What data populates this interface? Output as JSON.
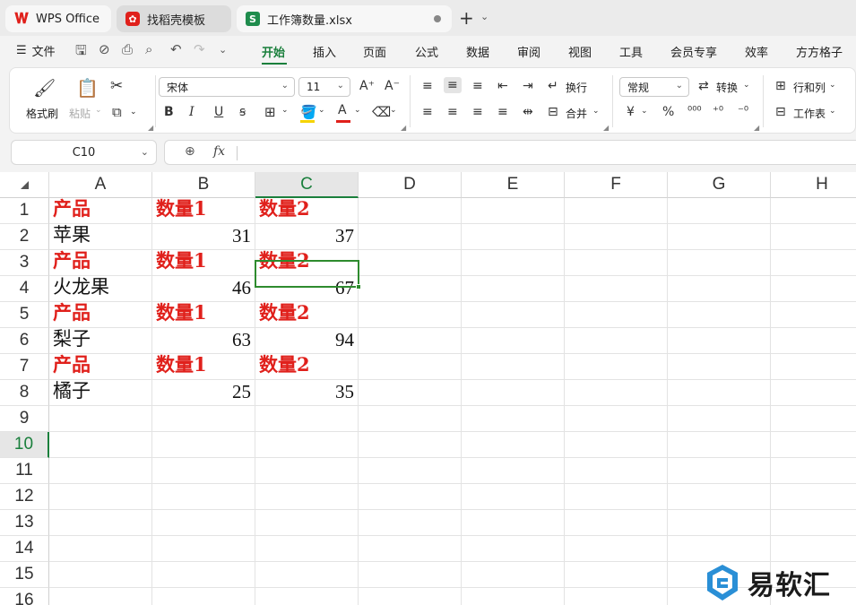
{
  "tabs": [
    {
      "label": "WPS Office",
      "icon": "wps-logo-icon"
    },
    {
      "label": "找稻壳模板",
      "icon": "docer-icon"
    },
    {
      "label": "工作簿数量.xlsx",
      "icon": "spreadsheet-s-icon",
      "badge": "S"
    }
  ],
  "menu": {
    "file": "文件",
    "items": [
      "开始",
      "插入",
      "页面",
      "公式",
      "数据",
      "审阅",
      "视图",
      "工具",
      "会员专享",
      "效率",
      "方方格子"
    ],
    "active": "开始"
  },
  "ribbon": {
    "format_painter": "格式刷",
    "paste": "粘贴",
    "font_name": "宋体",
    "font_size": "11",
    "wrap": "换行",
    "merge": "合并",
    "number_format": "常规",
    "convert": "转换",
    "rows_cols": "行和列",
    "worksheet": "工作表",
    "bold": "B",
    "italic": "I",
    "underline": "U",
    "strike": "ꞩ",
    "percent": "%",
    "font_color_letter": "A",
    "currency": "¥",
    "font_grow": "A⁺",
    "font_shrink": "A⁻"
  },
  "formula_bar": {
    "name_box": "C10",
    "fx": "fx",
    "formula": ""
  },
  "sheet": {
    "columns": [
      "A",
      "B",
      "C",
      "D",
      "E",
      "F",
      "G",
      "H"
    ],
    "rows": [
      "1",
      "2",
      "3",
      "4",
      "5",
      "6",
      "7",
      "8",
      "9",
      "10",
      "11",
      "12",
      "13",
      "14",
      "15",
      "16"
    ],
    "selected_column": "C",
    "selected_row": "10",
    "cells": [
      [
        "产品",
        "数量1",
        "数量2"
      ],
      [
        "苹果",
        "31",
        "37"
      ],
      [
        "产品",
        "数量1",
        "数量2"
      ],
      [
        "火龙果",
        "46",
        "67"
      ],
      [
        "产品",
        "数量1",
        "数量2"
      ],
      [
        "梨子",
        "63",
        "94"
      ],
      [
        "产品",
        "数量1",
        "数量2"
      ],
      [
        "橘子",
        "25",
        "35"
      ]
    ]
  },
  "colors": {
    "accent": "#1a7f3c",
    "header_text": "#e0201b"
  },
  "watermark": {
    "text": "易软汇"
  }
}
